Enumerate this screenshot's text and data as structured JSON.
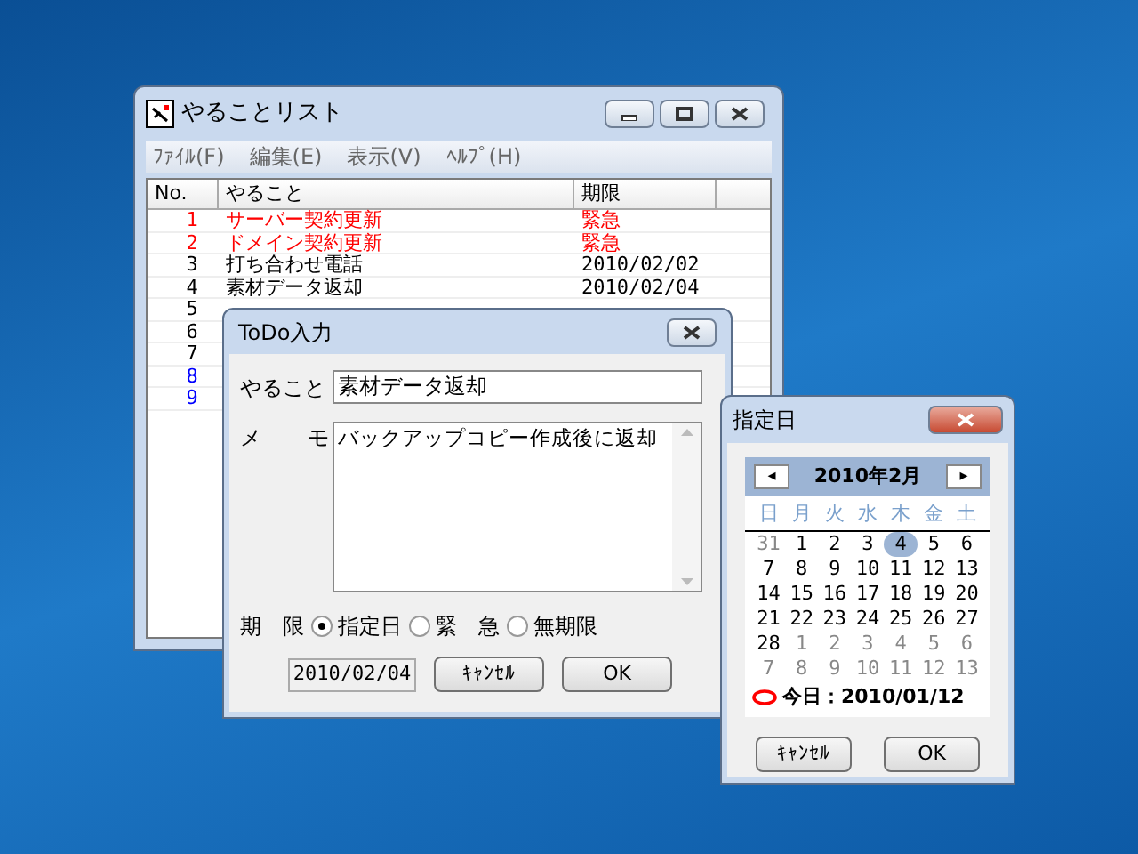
{
  "main_window": {
    "title": "やることリスト",
    "menu": [
      "ﾌｧｲﾙ(F)",
      "編集(E)",
      "表示(V)",
      "ﾍﾙﾌﾟ(H)"
    ],
    "table": {
      "columns": [
        "No.",
        "やること",
        "期限"
      ],
      "rows": [
        {
          "no": "1",
          "task": "サーバー契約更新",
          "deadline": "緊急",
          "color": "#ff0000"
        },
        {
          "no": "2",
          "task": "ドメイン契約更新",
          "deadline": "緊急",
          "color": "#ff0000"
        },
        {
          "no": "3",
          "task": "打ち合わせ電話",
          "deadline": "2010/02/02",
          "color": "#000000"
        },
        {
          "no": "4",
          "task": "素材データ返却",
          "deadline": "2010/02/04",
          "color": "#000000"
        },
        {
          "no": "5",
          "color": "#000000"
        },
        {
          "no": "6",
          "color": "#000000"
        },
        {
          "no": "7",
          "color": "#000000"
        },
        {
          "no": "8",
          "color": "#0000ff"
        },
        {
          "no": "9",
          "color": "#0000ff"
        }
      ]
    }
  },
  "todo_dialog": {
    "title": "ToDo入力",
    "task_label": "やること",
    "task_value": "素材データ返却",
    "memo_label": [
      "メ",
      "モ"
    ],
    "memo_value": "バックアップコピー作成後に返却",
    "deadline_label": [
      "期",
      "限"
    ],
    "deadline_options": [
      {
        "label": "指定日",
        "selected": true
      },
      {
        "label": "緊　急",
        "selected": false
      },
      {
        "label": "無期限",
        "selected": false
      }
    ],
    "date_value": "2010/02/04",
    "buttons": [
      "ｷｬﾝｾﾙ",
      "OK"
    ]
  },
  "calendar_dialog": {
    "title": "指定日",
    "prev": "◂",
    "month": "2010年2月",
    "next": "▸",
    "weekdays": [
      "日",
      "月",
      "火",
      "水",
      "木",
      "金",
      "土"
    ],
    "weeks": [
      [
        {
          "d": "31",
          "muted": true,
          "selected": false
        },
        {
          "d": "1",
          "muted": false,
          "selected": false
        },
        {
          "d": "2",
          "muted": false,
          "selected": false
        },
        {
          "d": "3",
          "muted": false,
          "selected": false
        },
        {
          "d": "4",
          "muted": false,
          "selected": true
        },
        {
          "d": "5",
          "muted": false,
          "selected": false
        },
        {
          "d": "6",
          "muted": false,
          "selected": false
        }
      ],
      [
        {
          "d": "7",
          "muted": false,
          "selected": false
        },
        {
          "d": "8",
          "muted": false,
          "selected": false
        },
        {
          "d": "9",
          "muted": false,
          "selected": false
        },
        {
          "d": "10",
          "muted": false,
          "selected": false
        },
        {
          "d": "11",
          "muted": false,
          "selected": false
        },
        {
          "d": "12",
          "muted": false,
          "selected": false
        },
        {
          "d": "13",
          "muted": false,
          "selected": false
        }
      ],
      [
        {
          "d": "14",
          "muted": false,
          "selected": false
        },
        {
          "d": "15",
          "muted": false,
          "selected": false
        },
        {
          "d": "16",
          "muted": false,
          "selected": false
        },
        {
          "d": "17",
          "muted": false,
          "selected": false
        },
        {
          "d": "18",
          "muted": false,
          "selected": false
        },
        {
          "d": "19",
          "muted": false,
          "selected": false
        },
        {
          "d": "20",
          "muted": false,
          "selected": false
        }
      ],
      [
        {
          "d": "21",
          "muted": false,
          "selected": false
        },
        {
          "d": "22",
          "muted": false,
          "selected": false
        },
        {
          "d": "23",
          "muted": false,
          "selected": false
        },
        {
          "d": "24",
          "muted": false,
          "selected": false
        },
        {
          "d": "25",
          "muted": false,
          "selected": false
        },
        {
          "d": "26",
          "muted": false,
          "selected": false
        },
        {
          "d": "27",
          "muted": false,
          "selected": false
        }
      ],
      [
        {
          "d": "28",
          "muted": false,
          "selected": false
        },
        {
          "d": "1",
          "muted": true,
          "selected": false
        },
        {
          "d": "2",
          "muted": true,
          "selected": false
        },
        {
          "d": "3",
          "muted": true,
          "selected": false
        },
        {
          "d": "4",
          "muted": true,
          "selected": false
        },
        {
          "d": "5",
          "muted": true,
          "selected": false
        },
        {
          "d": "6",
          "muted": true,
          "selected": false
        }
      ],
      [
        {
          "d": "7",
          "muted": true,
          "selected": false
        },
        {
          "d": "8",
          "muted": true,
          "selected": false
        },
        {
          "d": "9",
          "muted": true,
          "selected": false
        },
        {
          "d": "10",
          "muted": true,
          "selected": false
        },
        {
          "d": "11",
          "muted": true,
          "selected": false
        },
        {
          "d": "12",
          "muted": true,
          "selected": false
        },
        {
          "d": "13",
          "muted": true,
          "selected": false
        }
      ]
    ],
    "today": "今日：2010/01/12",
    "buttons": [
      "ｷｬﾝｾﾙ",
      "OK"
    ]
  }
}
